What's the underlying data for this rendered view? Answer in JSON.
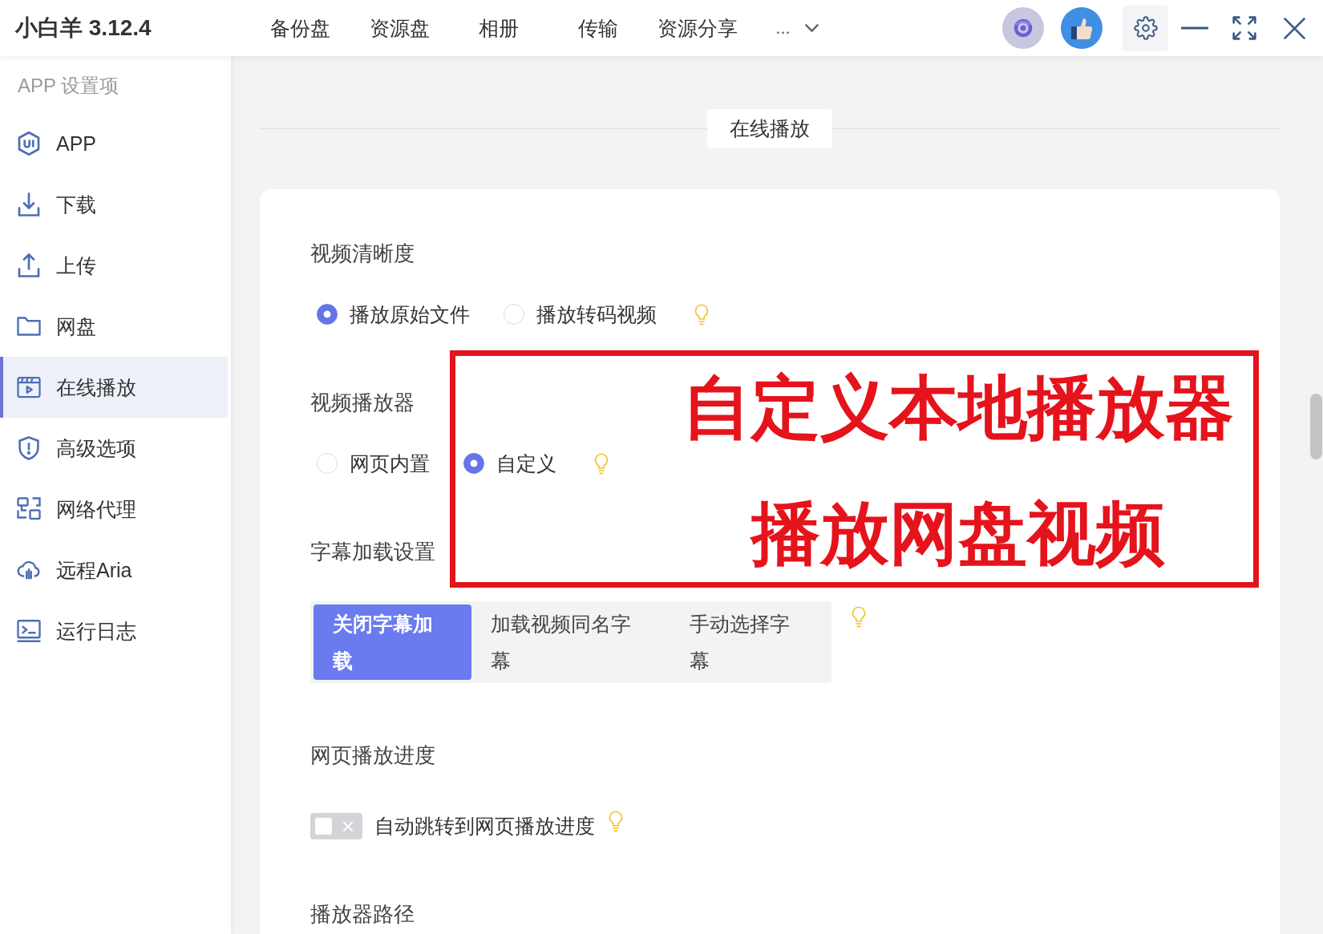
{
  "app": {
    "title": "小白羊 3.12.4"
  },
  "nav": [
    {
      "label": "备份盘"
    },
    {
      "label": "资源盘"
    },
    {
      "label": "相册"
    },
    {
      "label": "传输"
    },
    {
      "label": "资源分享"
    }
  ],
  "nav_more": {
    "label": "..."
  },
  "sidebar": {
    "heading": "APP 设置项",
    "items": [
      {
        "label": "APP",
        "selected": false
      },
      {
        "label": "下载",
        "selected": false
      },
      {
        "label": "上传",
        "selected": false
      },
      {
        "label": "网盘",
        "selected": false
      },
      {
        "label": "在线播放",
        "selected": true
      },
      {
        "label": "高级选项",
        "selected": false
      },
      {
        "label": "网络代理",
        "selected": false
      },
      {
        "label": "远程Aria",
        "selected": false
      },
      {
        "label": "运行日志",
        "selected": false
      }
    ]
  },
  "page": {
    "title": "在线播放"
  },
  "sections": [
    {
      "title": "视频清晰度",
      "kind": "radio",
      "options": [
        {
          "label": "播放原始文件",
          "selected": true
        },
        {
          "label": "播放转码视频",
          "selected": false
        }
      ]
    },
    {
      "title": "视频播放器",
      "kind": "radio",
      "options": [
        {
          "label": "网页内置",
          "selected": false
        },
        {
          "label": "自定义",
          "selected": true
        }
      ]
    },
    {
      "title": "字幕加载设置",
      "kind": "segmented",
      "options": [
        {
          "label": "关闭字幕加载",
          "selected": true
        },
        {
          "label": "加载视频同名字幕",
          "selected": false
        },
        {
          "label": "手动选择字幕",
          "selected": false
        }
      ]
    },
    {
      "title": "网页播放进度",
      "kind": "switch",
      "switch": {
        "label": "自动跳转到网页播放进度",
        "on": false
      }
    },
    {
      "title": "播放器路径",
      "kind": "heading"
    }
  ],
  "annotation": {
    "lines": [
      "自定义本地播放器",
      "播放网盘视频"
    ]
  }
}
